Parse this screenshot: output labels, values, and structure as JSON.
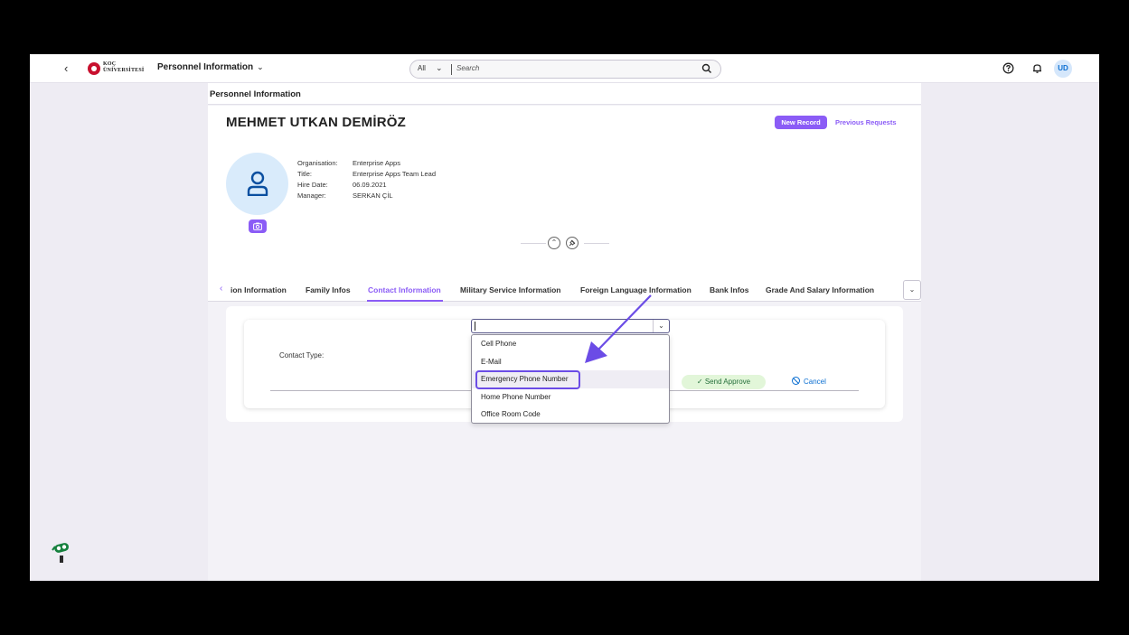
{
  "shell": {
    "back_icon": "chevron-left-icon",
    "logo_line1": "KOÇ",
    "logo_line2": "ÜNİVERSİTESİ",
    "app_title": "Personnel Information",
    "search_scope": "All",
    "search_placeholder": "Search",
    "avatar_initials": "UD"
  },
  "page": {
    "title": "Personnel Information",
    "employee_name": "MEHMET UTKAN DEMİRÖZ",
    "actions": {
      "new_record": "New Record",
      "previous_requests": "Previous Requests"
    },
    "attributes": [
      {
        "label": "Organisation:",
        "value": "Enterprise Apps"
      },
      {
        "label": "Title:",
        "value": "Enterprise Apps Team Lead"
      },
      {
        "label": "Hire Date:",
        "value": "06.09.2021"
      },
      {
        "label": "Manager:",
        "value": "SERKAN ÇİL"
      }
    ]
  },
  "tabs": [
    {
      "label": "ion Information",
      "active": false
    },
    {
      "label": "Family Infos",
      "active": false
    },
    {
      "label": "Contact Information",
      "active": true
    },
    {
      "label": "Military Service Information",
      "active": false
    },
    {
      "label": "Foreign Language Information",
      "active": false
    },
    {
      "label": "Bank Infos",
      "active": false
    },
    {
      "label": "Grade And Salary Information",
      "active": false
    }
  ],
  "form": {
    "contact_type_label": "Contact Type:",
    "contact_type_value": "",
    "send_approve": "Send Approve",
    "cancel": "Cancel",
    "options": [
      "Cell Phone",
      "E-Mail",
      "Emergency Phone Number",
      "Home Phone Number",
      "Office Room Code"
    ],
    "highlighted_option": "Emergency Phone Number"
  },
  "colors": {
    "accent": "#8b5cf6",
    "annotation": "#6b4ce6",
    "success_bg": "#e2f6d9",
    "link_blue": "#0a6ed1"
  }
}
